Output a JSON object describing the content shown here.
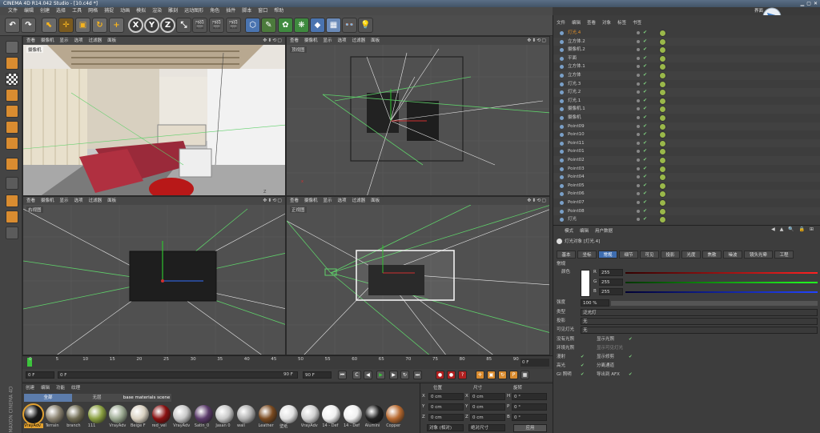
{
  "window": {
    "title": "CINEMA 4D R14.042 Studio - [10.c4d *]"
  },
  "menu": [
    "文件",
    "编辑",
    "创建",
    "选择",
    "工具",
    "网格",
    "捕捉",
    "动画",
    "模拟",
    "渲染",
    "雕刻",
    "运动图形",
    "角色",
    "插件",
    "脚本",
    "窗口",
    "帮助"
  ],
  "toolbar": {
    "mode_x": "X",
    "mode_y": "Y",
    "mode_z": "Z"
  },
  "viewport_menu": [
    "查看",
    "摄像机",
    "显示",
    "选项",
    "过滤器",
    "面板"
  ],
  "viewports": [
    {
      "label": "摄像机"
    },
    {
      "label": "顶视图"
    },
    {
      "label": "右视图"
    },
    {
      "label": "正视图"
    }
  ],
  "objects": {
    "menu": [
      "文件",
      "编辑",
      "查看",
      "对象",
      "标签",
      "书签"
    ],
    "items": [
      "灯光.4",
      "立方体.2",
      "摄像机.2",
      "平面",
      "立方体.1",
      "立方体",
      "灯光.3",
      "灯光.2",
      "灯光.1",
      "摄像机.1",
      "摄像机",
      "Point09",
      "Point10",
      "Point11",
      "Point01",
      "Point02",
      "Point03",
      "Point04",
      "Point05",
      "Point06",
      "Point07",
      "Point08",
      "灯光"
    ]
  },
  "attributes": {
    "menu": [
      "模式",
      "编辑",
      "用户数据"
    ],
    "object_title": "灯光对象 [灯光.4]",
    "tabs": [
      "基本",
      "坐标",
      "常规",
      "细节",
      "可见",
      "投影",
      "光度",
      "焦散",
      "噪波",
      "镜头光晕",
      "工程"
    ],
    "section": "常规",
    "color_label": "颜色",
    "r_label": "R",
    "r_value": "255",
    "g_label": "G",
    "g_value": "255",
    "b_label": "B",
    "b_value": "255",
    "intensity_label": "强度",
    "intensity_value": "100 %",
    "type_label": "类型",
    "type_value": "泛光灯",
    "shadow_label": "投影",
    "shadow_value": "无",
    "visible_light_label": "可见灯光",
    "visible_light_value": "无",
    "no_illum_label": "没有光照",
    "ambient_label": "环境光照",
    "diffuse_label": "漫射",
    "specular_label": "高光",
    "gi_label": "GI 照明",
    "show_illum_label": "显示光照",
    "show_visible_label": "显示可见灯光",
    "show_clip_label": "显示修剪",
    "sep_pass_label": "分离通道",
    "export_afx_label": "导出到 AFX"
  },
  "timeline": {
    "ticks": [
      "0",
      "5",
      "10",
      "15",
      "20",
      "25",
      "30",
      "35",
      "40",
      "45",
      "50",
      "55",
      "60",
      "65",
      "70",
      "75",
      "80",
      "85",
      "90"
    ],
    "frame_end": "0 F",
    "start": "0 F",
    "current": "0 F",
    "preview_end": "90 F",
    "end": "90 F"
  },
  "materials": {
    "menu": [
      "创建",
      "编辑",
      "功能",
      "纹理"
    ],
    "groups": [
      "全部",
      "无层",
      "base materials scene"
    ],
    "items": [
      {
        "name": "VrayAdv",
        "color": "#1a1a1a"
      },
      {
        "name": "Terrain",
        "color": "#8a8270"
      },
      {
        "name": "branch",
        "color": "#6e6a52"
      },
      {
        "name": "111",
        "color": "#8aa040"
      },
      {
        "name": "VrayAdv",
        "color": "#9aa890"
      },
      {
        "name": "Beige F",
        "color": "#d8d0c0"
      },
      {
        "name": "red_vel",
        "color": "#8a1010"
      },
      {
        "name": "VrayAdv",
        "color": "#c8c8c8"
      },
      {
        "name": "Satin_0",
        "color": "#5a3a6a"
      },
      {
        "name": "Jasan 0",
        "color": "#c8c8c8"
      },
      {
        "name": "wall",
        "color": "#b0b0b0"
      },
      {
        "name": "Leather",
        "color": "#7a4a20"
      },
      {
        "name": "壁纸",
        "color": "#e0e0e0"
      },
      {
        "name": "VrayAdv",
        "color": "#d0d0d0"
      },
      {
        "name": "14 - Def",
        "color": "#f0f0f0"
      },
      {
        "name": "14 - Def",
        "color": "#f0f0f0"
      },
      {
        "name": "Alumini",
        "color": "#222222"
      },
      {
        "name": "Copper",
        "color": "#b86a30"
      }
    ]
  },
  "coords": {
    "headers": [
      "位置",
      "尺寸",
      "旋转"
    ],
    "rows": [
      {
        "axis": "X",
        "pos": "0 cm",
        "size_axis": "X",
        "size": "0 cm",
        "rot_axis": "H",
        "rot": "0 °"
      },
      {
        "axis": "Y",
        "pos": "0 cm",
        "size_axis": "Y",
        "size": "0 cm",
        "rot_axis": "P",
        "rot": "0 °"
      },
      {
        "axis": "Z",
        "pos": "0 cm",
        "size_axis": "Z",
        "size": "0 cm",
        "rot_axis": "B",
        "rot": "0 °"
      }
    ],
    "mode_object": "对象 (相对)",
    "mode_size": "绝对尺寸",
    "apply": "应用"
  },
  "brand": {
    "layout_label": "界面"
  },
  "maxon_label": "MAXON CINEMA 4D",
  "colors": {
    "accent": "#3e6db0",
    "selected_obj": "#e0902a",
    "green_line": "#5fd06a"
  }
}
